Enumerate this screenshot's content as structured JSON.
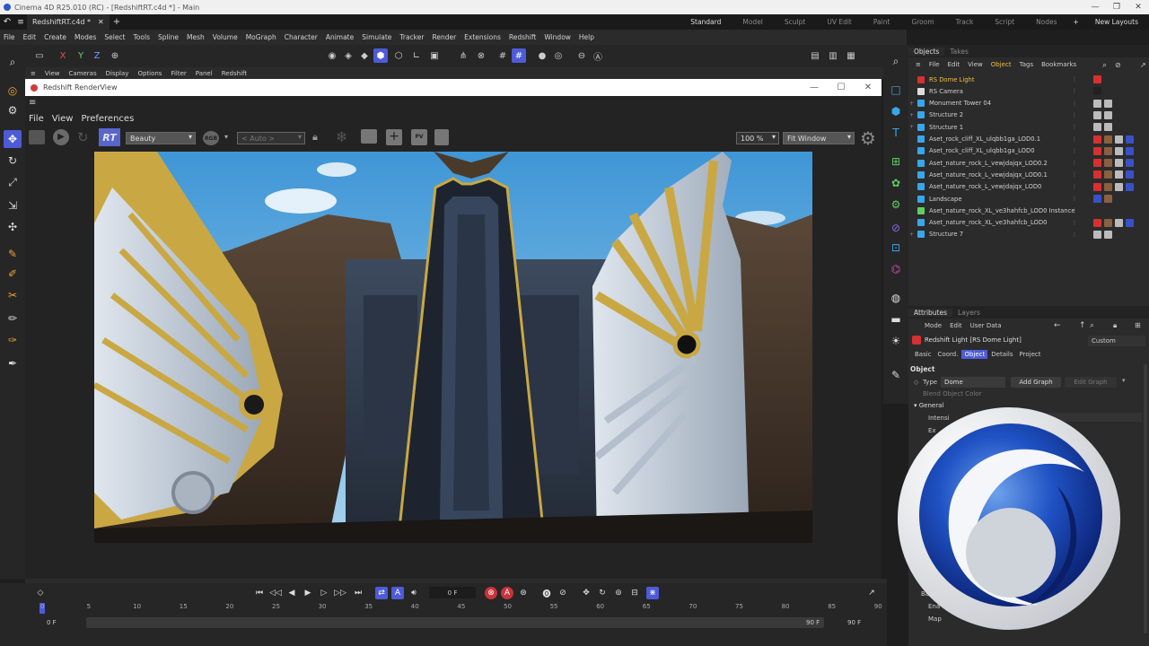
{
  "app": {
    "window_title": "Cinema 4D R25.010 (RC) - [RedshiftRT.c4d *] - Main",
    "document_tab": "RedshiftRT.c4d *",
    "layouts": [
      "Standard",
      "Model",
      "Sculpt",
      "UV Edit",
      "Paint",
      "Groom",
      "Track",
      "Script",
      "Nodes"
    ],
    "new_layouts": "New Layouts"
  },
  "menubar": [
    "File",
    "Edit",
    "Create",
    "Modes",
    "Select",
    "Tools",
    "Spline",
    "Mesh",
    "Volume",
    "MoGraph",
    "Character",
    "Animate",
    "Simulate",
    "Tracker",
    "Render",
    "Extensions",
    "Redshift",
    "Window",
    "Help"
  ],
  "toolbar": {
    "axis_x": "X",
    "axis_y": "Y",
    "axis_z": "Z"
  },
  "viewport_menu": [
    "View",
    "Cameras",
    "Display",
    "Options",
    "Filter",
    "Panel",
    "Redshift"
  ],
  "renderview": {
    "title": "Redshift RenderView",
    "menu": [
      "File",
      "View",
      "Preferences"
    ],
    "rt_label": "RT",
    "aov": "Beauty",
    "rgb": "RGB",
    "auto": "< Auto >",
    "zoom": "100 %",
    "fit": "Fit Window"
  },
  "timeline": {
    "frame": "0 F",
    "start": "0 F",
    "start2": "0 F",
    "end": "90 F",
    "end2": "90 F",
    "ticks": [
      "0",
      "5",
      "10",
      "15",
      "20",
      "25",
      "30",
      "35",
      "40",
      "45",
      "50",
      "55",
      "60",
      "65",
      "70",
      "75",
      "80",
      "85",
      "90"
    ]
  },
  "objects_panel": {
    "tabs": [
      "Objects",
      "Takes"
    ],
    "menu": [
      "File",
      "Edit",
      "View",
      "Object",
      "Tags",
      "Bookmarks"
    ],
    "rows": [
      "RS Dome Light",
      "RS Camera",
      "Monument Tower 04",
      "Structure 2",
      "Structure 1",
      "Aset_rock_cliff_XL_ulqbb1ga_LOD0.1",
      "Aset_rock_cliff_XL_ulqbb1ga_LOD0",
      "Aset_nature_rock_L_vewjdajqx_LOD0.2",
      "Aset_nature_rock_L_vewjdajqx_LOD0.1",
      "Aset_nature_rock_L_vewjdajqx_LOD0",
      "Landscape",
      "Aset_nature_rock_XL_ve3hahfcb_LOD0 Instance",
      "Aset_nature_rock_XL_ve3hahfcb_LOD0",
      "Structure 7"
    ]
  },
  "attributes_panel": {
    "tabs": [
      "Attributes",
      "Layers"
    ],
    "menu": [
      "Mode",
      "Edit",
      "User Data"
    ],
    "object_title": "Redshift Light [RS Dome Light]",
    "preset": "Custom",
    "subtabs": [
      "Basic",
      "Coord.",
      "Object",
      "Details",
      "Project"
    ],
    "section": "Object",
    "type_label": "Type",
    "type_value": "Dome",
    "add_graph": "Add Graph",
    "edit_graph": "Edit Graph",
    "blend_label": "Blend Object Color",
    "general": "General",
    "intensity": "Intensi",
    "exposure": "Ex",
    "bake_label": "Ba",
    "enable_label": "Ena",
    "map_label": "Map"
  },
  "colors": {
    "accent": "#4d5bd8",
    "logo_blue": "#1a3fa8",
    "sky": "#6fb6e4"
  }
}
